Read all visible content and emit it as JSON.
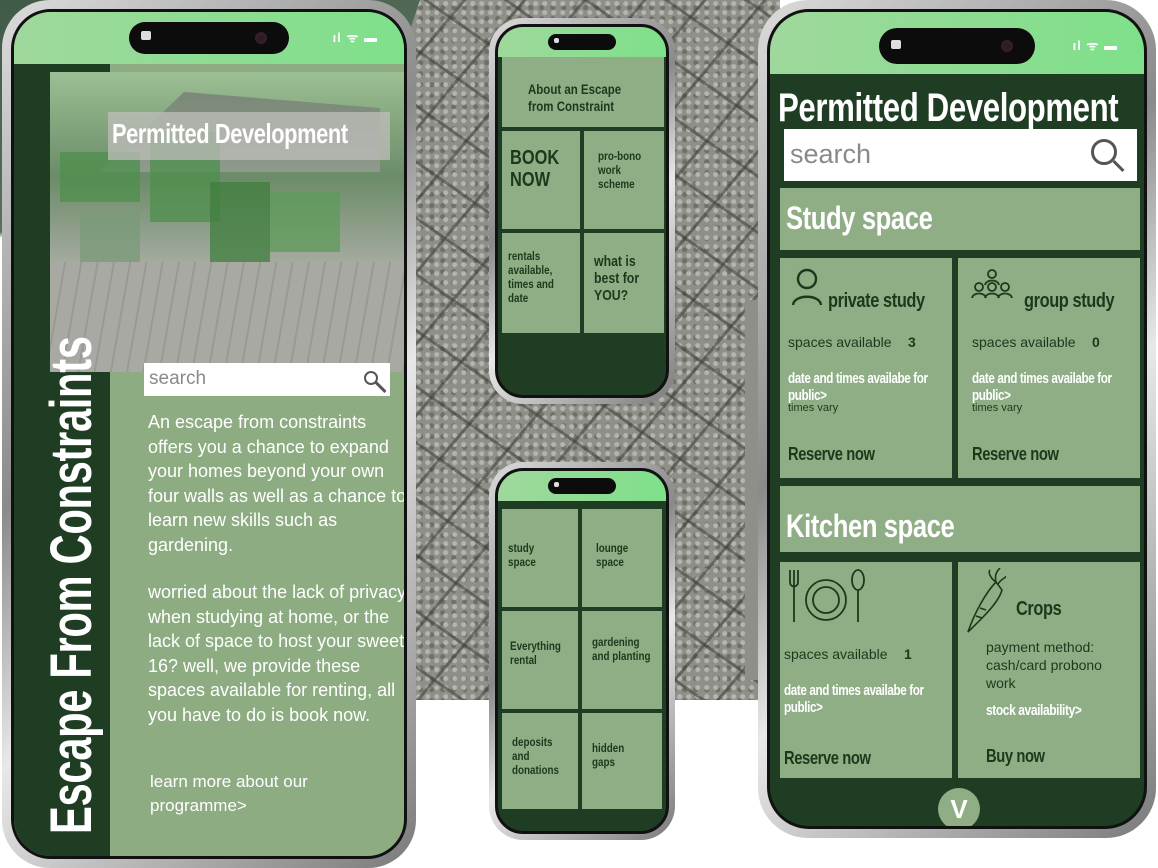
{
  "phone_left": {
    "hero_title": "Permitted Development",
    "vertical_title": "Escape From Constraints",
    "search_placeholder": "search",
    "paragraph1": "An escape from constraints offers you a chance to expand your homes beyond your own four walls as well as a chance to learn new skills such as gardening.",
    "paragraph2": "worried about the lack of privacy when studying at home, or the lack of space to host your sweet 16?  well, we provide these spaces available for renting, all you have to do is book now.",
    "learn_more": "learn more about our programme>"
  },
  "phone_mid_top": {
    "about": "About an Escape from Constraint",
    "book_now": "BOOK NOW",
    "pro_bono": "pro-bono work scheme",
    "rentals": "rentals available, times and date",
    "best": "what is best for YOU?"
  },
  "phone_mid_bottom": {
    "study": "study space",
    "lounge": "lounge space",
    "everything": "Everything rental",
    "gardening": "gardening and planting",
    "deposits": "deposits and donations",
    "hidden": "hidden gaps"
  },
  "phone_right": {
    "title": "Permitted Development",
    "search_placeholder": "search",
    "study_section": "Study space",
    "private_study": {
      "label": "private study",
      "spaces_label": "spaces available",
      "spaces_value": "3",
      "date_times": "date and times availabe for public>",
      "times_vary": "times vary",
      "reserve": "Reserve now"
    },
    "group_study": {
      "label": "group study",
      "spaces_label": "spaces available",
      "spaces_value": "0",
      "date_times": "date and times availabe for public>",
      "times_vary": "times vary",
      "reserve": "Reserve now"
    },
    "kitchen_section": "Kitchen space",
    "kitchen": {
      "spaces_label": "spaces available",
      "spaces_value": "1",
      "date_times": "date and times availabe for public>",
      "reserve": "Reserve now"
    },
    "crops": {
      "label": "Crops",
      "payment": "payment method: cash/card probono work",
      "stock": "stock availability>",
      "buy": "Buy now"
    },
    "scroll_button": "V"
  },
  "colors": {
    "dark_green": "#1f3d22",
    "tile_green": "#8fae86",
    "status_green": "#7ee08a"
  },
  "status_signal": "ıl ᯤ ▬"
}
